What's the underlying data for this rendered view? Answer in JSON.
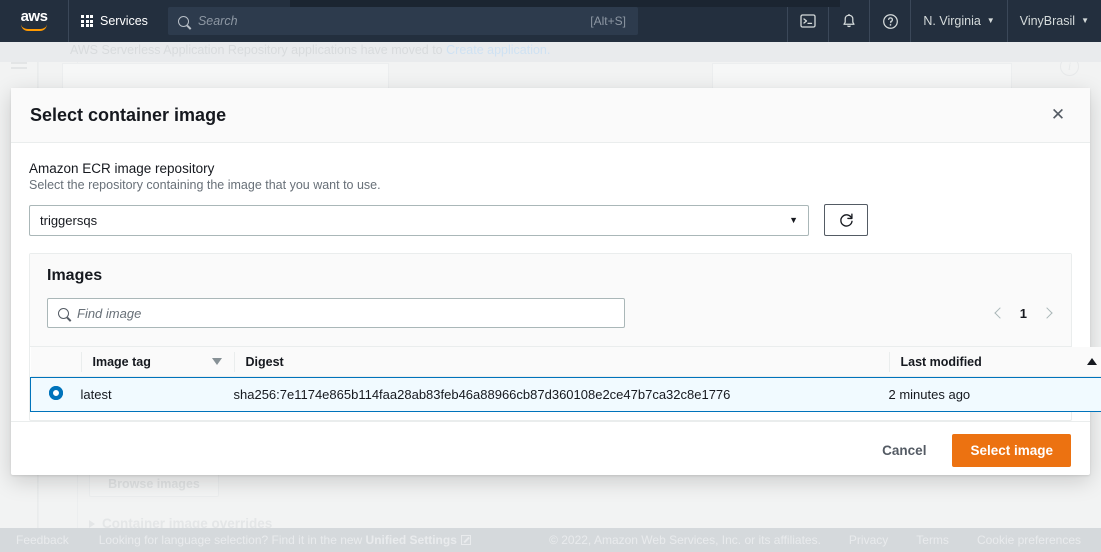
{
  "topnav": {
    "logo_text": "aws",
    "services_label": "Services",
    "search_placeholder": "Search",
    "search_shortcut": "[Alt+S]",
    "cloudshell_icon": "cloudshell-icon",
    "bell_icon": "bell-icon",
    "help_icon": "help-icon",
    "region_label": "N. Virginia",
    "account_label": "VinyBrasil",
    "caret": "▼"
  },
  "background": {
    "banner_text": "AWS Serverless Application Repository applications have moved to ",
    "banner_link": "Create application.",
    "browse_images_label": "Browse images",
    "overrides_label": "Container image overrides"
  },
  "modal": {
    "title": "Select container image",
    "close_icon": "close-icon",
    "field": {
      "label": "Amazon ECR image repository",
      "description": "Select the repository containing the image that you want to use.",
      "selected_repository": "triggersqs",
      "caret": "▼",
      "refresh_icon": "refresh-icon"
    },
    "images": {
      "title": "Images",
      "find_placeholder": "Find image",
      "search_icon": "search-icon",
      "pagination": {
        "prev_icon": "chevron-left-icon",
        "page": "1",
        "next_icon": "chevron-right-icon"
      },
      "columns": [
        {
          "label": "Image tag",
          "sort": "down"
        },
        {
          "label": "Digest",
          "sort": "none"
        },
        {
          "label": "Last modified",
          "sort": "up-active"
        }
      ],
      "rows": [
        {
          "selected": true,
          "image_tag": "latest",
          "digest": "sha256:7e1174e865b114faa28ab83feb46a88966cb87d360108e2ce47b7ca32c8e1776",
          "last_modified": "2 minutes ago"
        }
      ]
    },
    "cancel_label": "Cancel",
    "submit_label": "Select image"
  },
  "footer": {
    "feedback": "Feedback",
    "language_prompt": "Looking for language selection? Find it in the new ",
    "language_link": "Unified Settings",
    "copyright": "© 2022, Amazon Web Services, Inc. or its affiliates.",
    "privacy": "Privacy",
    "terms": "Terms",
    "cookies": "Cookie preferences"
  },
  "colors": {
    "accent_orange": "#ec7211",
    "link_blue": "#0073bb",
    "nav_dark": "#232f3e",
    "selected_row_bg": "#f1faff"
  }
}
